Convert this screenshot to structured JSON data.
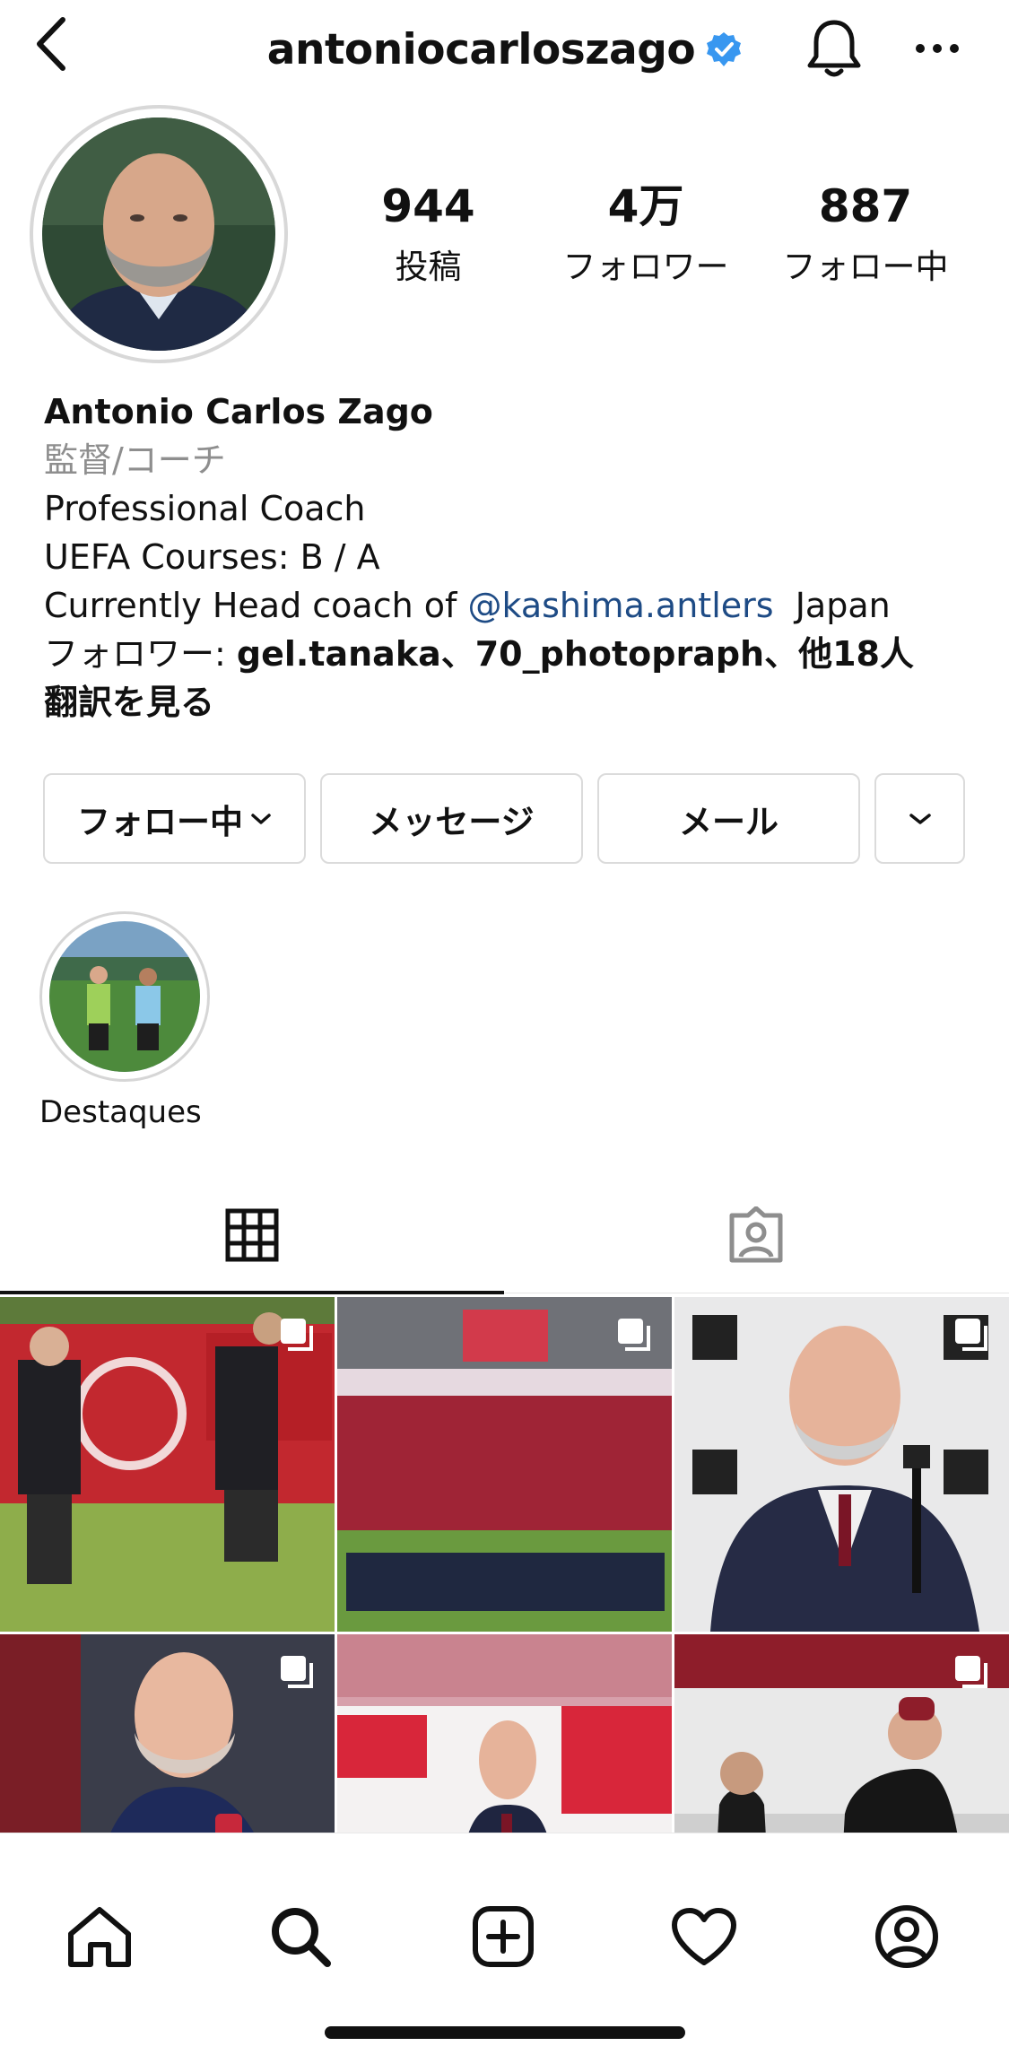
{
  "header": {
    "username": "antoniocarloszago",
    "verified_color": "#3897f0"
  },
  "stats": {
    "posts_count": "944",
    "posts_label": "投稿",
    "followers_count": "4万",
    "followers_label": "フォロワー",
    "following_count": "887",
    "following_label": "フォロー中"
  },
  "bio": {
    "name": "Antonio Carlos Zago",
    "category": "監督/コーチ",
    "line1": "Professional Coach",
    "line2": "UEFA Courses: B / A",
    "line3_prefix": "Currently Head coach of ",
    "line3_mention": "@kashima.antlers",
    "line3_suffix": "  Japan",
    "followed_by_prefix": "フォロワー: ",
    "followed_by_names": "gel.tanaka、70_photopraph、他18人",
    "translate": "翻訳を見る"
  },
  "buttons": {
    "following": "フォロー中",
    "message": "メッセージ",
    "mail": "メール"
  },
  "highlight": {
    "label": "Destaques"
  },
  "tabs": [
    {
      "icon": "grid-icon",
      "active": true
    },
    {
      "icon": "tagged-icon",
      "active": false
    }
  ],
  "posts": [
    {
      "icon": "multi-post-icon"
    },
    {
      "icon": "multi-post-icon"
    },
    {
      "icon": "multi-post-icon"
    },
    {
      "icon": "multi-post-icon"
    },
    {
      "icon": ""
    },
    {
      "icon": "multi-post-icon"
    }
  ],
  "nav": [
    "home-icon",
    "search-icon",
    "add-post-icon",
    "heart-icon",
    "profile-icon"
  ],
  "colors": {
    "mention": "#1e4b85",
    "secondary_text": "#8e8e8e",
    "kashima_red": "#b0102a"
  }
}
